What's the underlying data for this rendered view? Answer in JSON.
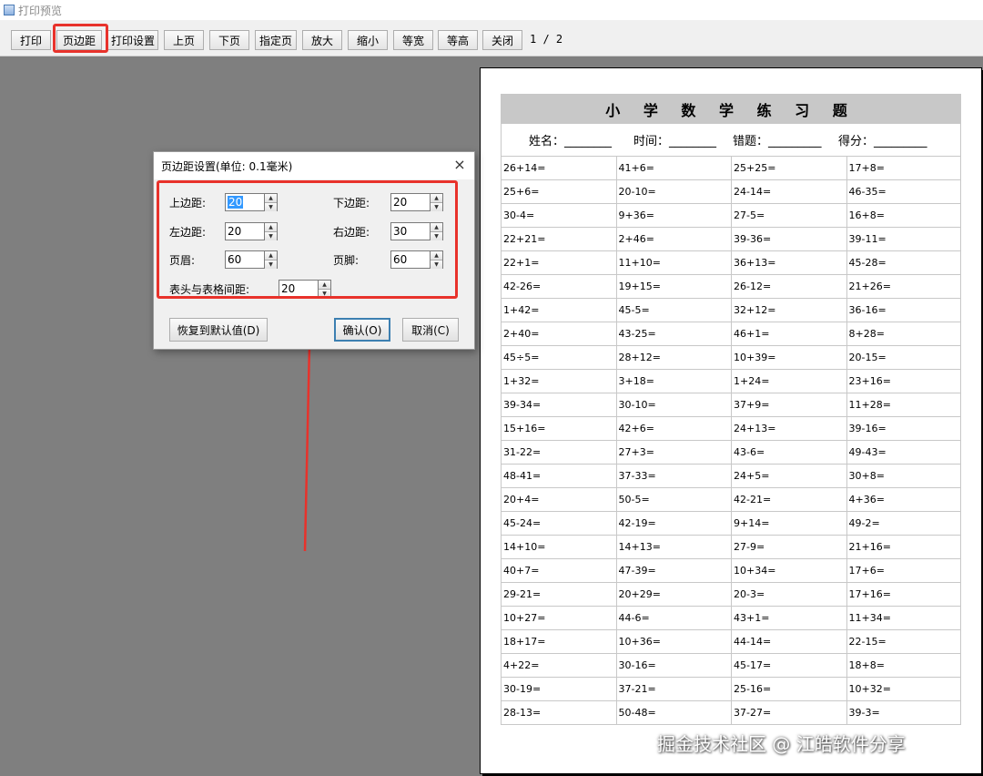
{
  "window": {
    "title": "打印预览"
  },
  "toolbar": {
    "buttons": [
      "打印",
      "页边距",
      "打印设置",
      "上页",
      "下页",
      "指定页",
      "放大",
      "缩小",
      "等宽",
      "等高",
      "关闭"
    ],
    "page_indicator": "1 / 2"
  },
  "dialog": {
    "title": "页边距设置(单位: 0.1毫米)",
    "close_glyph": "×",
    "fields": {
      "top": {
        "label": "上边距:",
        "value": "20"
      },
      "bottom": {
        "label": "下边距:",
        "value": "20"
      },
      "left": {
        "label": "左边距:",
        "value": "20"
      },
      "right": {
        "label": "右边距:",
        "value": "30"
      },
      "header": {
        "label": "页眉:",
        "value": "60"
      },
      "footer": {
        "label": "页脚:",
        "value": "60"
      },
      "spacing": {
        "label": "表头与表格间距:",
        "value": "20"
      }
    },
    "buttons": {
      "restore": "恢复到默认值(D)",
      "ok": "确认(O)",
      "cancel": "取消(C)"
    }
  },
  "worksheet": {
    "title": "小 学 数 学 练 习 题",
    "name_label": "姓名：________",
    "time_label": "时间：________",
    "errors_label": "错题：_________",
    "score_label": "得分：_________",
    "rows": [
      [
        "26+14=",
        "41+6=",
        "25+25=",
        "17+8="
      ],
      [
        "25+6=",
        "20-10=",
        "24-14=",
        "46-35="
      ],
      [
        "30-4=",
        "9+36=",
        "27-5=",
        "16+8="
      ],
      [
        "22+21=",
        "2+46=",
        "39-36=",
        "39-11="
      ],
      [
        "22+1=",
        "11+10=",
        "36+13=",
        "45-28="
      ],
      [
        "42-26=",
        "19+15=",
        "26-12=",
        "21+26="
      ],
      [
        "1+42=",
        "45-5=",
        "32+12=",
        "36-16="
      ],
      [
        "2+40=",
        "43-25=",
        "46+1=",
        "8+28="
      ],
      [
        "45÷5=",
        "28+12=",
        "10+39=",
        "20-15="
      ],
      [
        "1+32=",
        "3+18=",
        "1+24=",
        "23+16="
      ],
      [
        "39-34=",
        "30-10=",
        "37+9=",
        "11+28="
      ],
      [
        "15+16=",
        "42+6=",
        "24+13=",
        "39-16="
      ],
      [
        "31-22=",
        "27+3=",
        "43-6=",
        "49-43="
      ],
      [
        "48-41=",
        "37-33=",
        "24+5=",
        "30+8="
      ],
      [
        "20+4=",
        "50-5=",
        "42-21=",
        "4+36="
      ],
      [
        "45-24=",
        "42-19=",
        "9+14=",
        "49-2="
      ],
      [
        "14+10=",
        "14+13=",
        "27-9=",
        "21+16="
      ],
      [
        "40+7=",
        "47-39=",
        "10+34=",
        "17+6="
      ],
      [
        "29-21=",
        "20+29=",
        "20-3=",
        "17+16="
      ],
      [
        "10+27=",
        "44-6=",
        "43+1=",
        "11+34="
      ],
      [
        "18+17=",
        "10+36=",
        "44-14=",
        "22-15="
      ],
      [
        "4+22=",
        "30-16=",
        "45-17=",
        "18+8="
      ],
      [
        "30-19=",
        "37-21=",
        "25-16=",
        "10+32="
      ],
      [
        "28-13=",
        "50-48=",
        "37-27=",
        "39-3="
      ]
    ]
  },
  "watermark": "掘金技术社区 @ 江皓软件分享"
}
